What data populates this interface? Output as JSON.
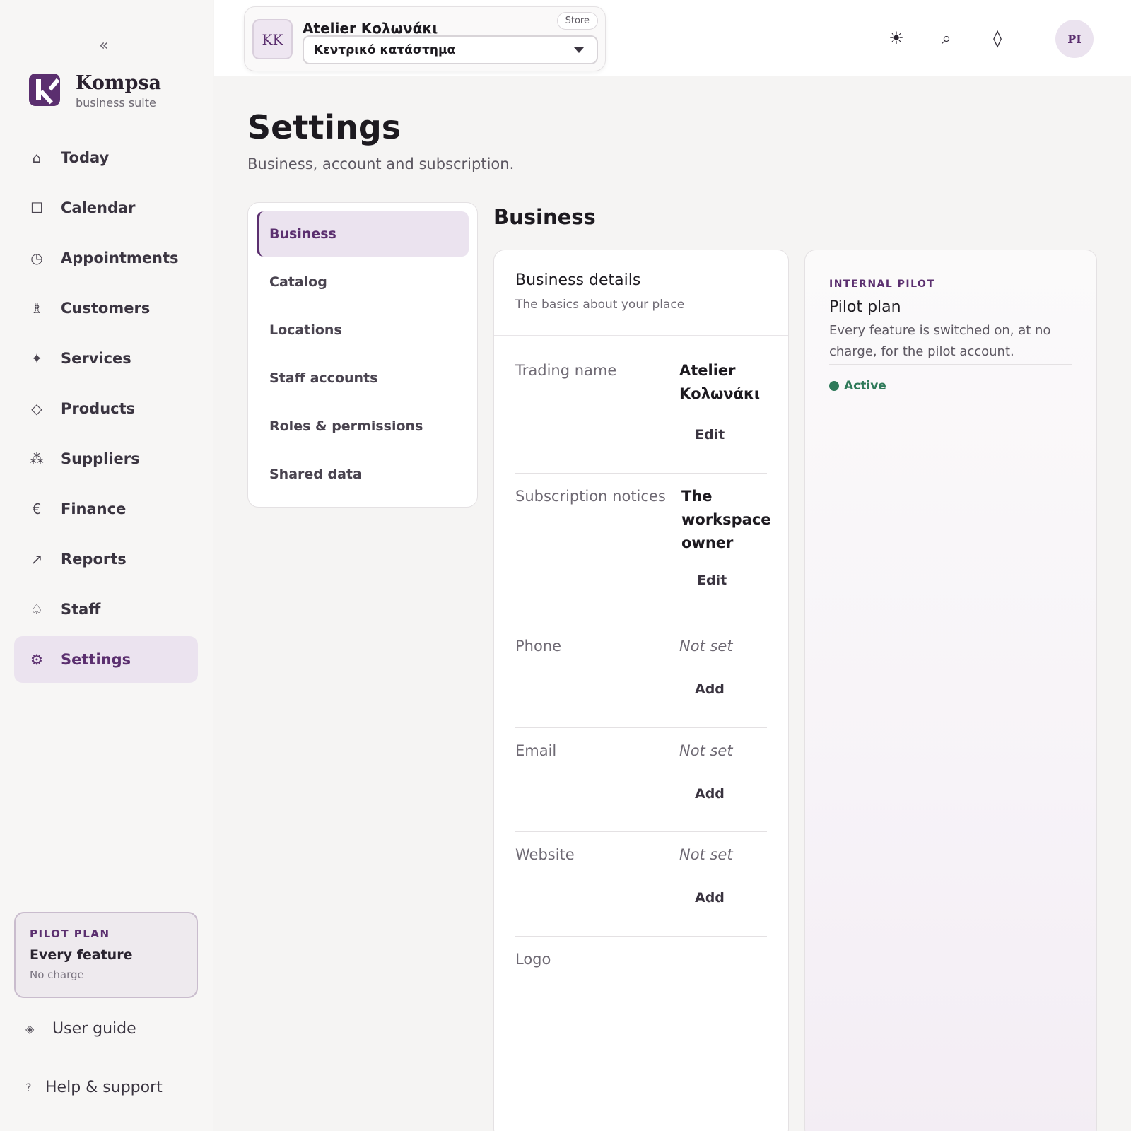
{
  "sidebar": {
    "collapse_icon": "«",
    "brand": {
      "name": "Kompsa",
      "tagline": "business suite"
    },
    "items": [
      {
        "label": "Today",
        "icon": "⌂",
        "icon_name": "home-icon"
      },
      {
        "label": "Calendar",
        "icon": "☐",
        "icon_name": "calendar-icon"
      },
      {
        "label": "Appointments",
        "icon": "◷",
        "icon_name": "clock-icon"
      },
      {
        "label": "Customers",
        "icon": "♗",
        "icon_name": "customers-icon"
      },
      {
        "label": "Services",
        "icon": "✦",
        "icon_name": "sparkle-icon"
      },
      {
        "label": "Products",
        "icon": "◇",
        "icon_name": "diamond-icon"
      },
      {
        "label": "Suppliers",
        "icon": "⁂",
        "icon_name": "suppliers-icon"
      },
      {
        "label": "Finance",
        "icon": "€",
        "icon_name": "euro-icon"
      },
      {
        "label": "Reports",
        "icon": "↗",
        "icon_name": "arrow-up-right-icon"
      },
      {
        "label": "Staff",
        "icon": "♤",
        "icon_name": "staff-icon"
      },
      {
        "label": "Settings",
        "icon": "⚙",
        "icon_name": "gear-icon",
        "active": true
      }
    ],
    "plan": {
      "kicker": "PILOT PLAN",
      "title": "Every feature",
      "subtitle": "No charge"
    },
    "footer": [
      {
        "label": "User guide",
        "icon": "◈"
      },
      {
        "label": "Help & support",
        "icon": "?"
      }
    ]
  },
  "topbar": {
    "store": {
      "initials": "KK",
      "name": "Atelier Κολωνάκι",
      "badge": "Store",
      "location": "Κεντρικό κατάστημα"
    },
    "icons": {
      "theme": "☀",
      "search": "⌕",
      "hint": "◊"
    },
    "user_initials": "PI"
  },
  "page": {
    "title": "Settings",
    "subtitle": "Business, account and subscription."
  },
  "tabs": [
    {
      "label": "Business",
      "active": true
    },
    {
      "label": "Catalog"
    },
    {
      "label": "Locations"
    },
    {
      "label": "Staff accounts"
    },
    {
      "label": "Roles & permissions"
    },
    {
      "label": "Shared data"
    }
  ],
  "section": {
    "title": "Business",
    "details": {
      "title": "Business details",
      "subtitle": "The basics about your place",
      "rows": [
        {
          "label": "Trading name",
          "value": "Atelier Κολωνάκι",
          "action": "Edit"
        },
        {
          "label": "Subscription notices",
          "value": "The workspace owner",
          "action": "Edit"
        },
        {
          "label": "Phone",
          "value": "Not set",
          "action": "Add"
        },
        {
          "label": "Email",
          "value": "Not set",
          "action": "Add"
        },
        {
          "label": "Website",
          "value": "Not set",
          "action": "Add"
        },
        {
          "label": "Logo"
        }
      ]
    },
    "pilot": {
      "kicker": "INTERNAL PILOT",
      "title": "Pilot plan",
      "description": "Every feature is switched on, at no charge, for the pilot account.",
      "status": "Active"
    }
  },
  "colors": {
    "brand": "#5b2f6f",
    "active_bg": "#ebe3ef",
    "status_green": "#2f7a5a"
  }
}
